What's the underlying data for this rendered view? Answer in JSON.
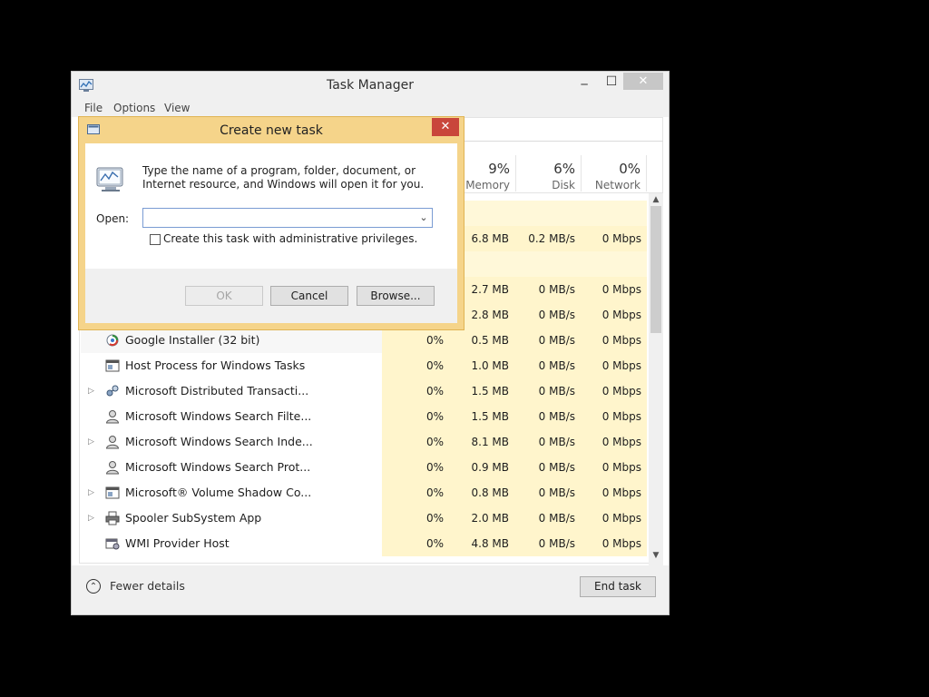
{
  "window": {
    "title": "Task Manager",
    "minimize": "─",
    "maximize": "☐",
    "close": "✕"
  },
  "menu": [
    "File",
    "Options",
    "View"
  ],
  "columns": [
    {
      "pct": "9%",
      "label": "Memory"
    },
    {
      "pct": "6%",
      "label": "Disk"
    },
    {
      "pct": "0%",
      "label": "Network"
    }
  ],
  "hidden_rows": [
    {
      "memory": "6.8 MB",
      "disk": "0.2 MB/s",
      "network": "0 Mbps"
    },
    {
      "memory": "2.7 MB",
      "disk": "0 MB/s",
      "network": "0 Mbps"
    },
    {
      "memory": "2.8 MB",
      "disk": "0 MB/s",
      "network": "0 Mbps"
    }
  ],
  "processes": [
    {
      "name": "Google Installer (32 bit)",
      "cpu": "0%",
      "memory": "0.5 MB",
      "disk": "0 MB/s",
      "network": "0 Mbps",
      "expand": false,
      "icon": "google-installer-icon"
    },
    {
      "name": "Host Process for Windows Tasks",
      "cpu": "0%",
      "memory": "1.0 MB",
      "disk": "0 MB/s",
      "network": "0 Mbps",
      "expand": false,
      "icon": "window-app-icon"
    },
    {
      "name": "Microsoft Distributed Transacti...",
      "cpu": "0%",
      "memory": "1.5 MB",
      "disk": "0 MB/s",
      "network": "0 Mbps",
      "expand": true,
      "icon": "network-service-icon"
    },
    {
      "name": "Microsoft Windows Search Filte...",
      "cpu": "0%",
      "memory": "1.5 MB",
      "disk": "0 MB/s",
      "network": "0 Mbps",
      "expand": false,
      "icon": "user-search-icon"
    },
    {
      "name": "Microsoft Windows Search Inde...",
      "cpu": "0%",
      "memory": "8.1 MB",
      "disk": "0 MB/s",
      "network": "0 Mbps",
      "expand": true,
      "icon": "user-search-icon"
    },
    {
      "name": "Microsoft Windows Search Prot...",
      "cpu": "0%",
      "memory": "0.9 MB",
      "disk": "0 MB/s",
      "network": "0 Mbps",
      "expand": false,
      "icon": "user-search-icon"
    },
    {
      "name": "Microsoft® Volume Shadow Co...",
      "cpu": "0%",
      "memory": "0.8 MB",
      "disk": "0 MB/s",
      "network": "0 Mbps",
      "expand": true,
      "icon": "window-app-icon"
    },
    {
      "name": "Spooler SubSystem App",
      "cpu": "0%",
      "memory": "2.0 MB",
      "disk": "0 MB/s",
      "network": "0 Mbps",
      "expand": true,
      "icon": "printer-icon"
    },
    {
      "name": "WMI Provider Host",
      "cpu": "0%",
      "memory": "4.8 MB",
      "disk": "0 MB/s",
      "network": "0 Mbps",
      "expand": false,
      "icon": "wmi-host-icon"
    }
  ],
  "footer": {
    "fewer_details": "Fewer details",
    "end_task": "End task"
  },
  "dialog": {
    "title": "Create new task",
    "close": "✕",
    "message": "Type the name of a program, folder, document, or Internet resource, and Windows will open it for you.",
    "open_label": "Open:",
    "open_value": "",
    "admin_label": "Create this task with administrative privileges.",
    "ok": "OK",
    "cancel": "Cancel",
    "browse": "Browse..."
  }
}
